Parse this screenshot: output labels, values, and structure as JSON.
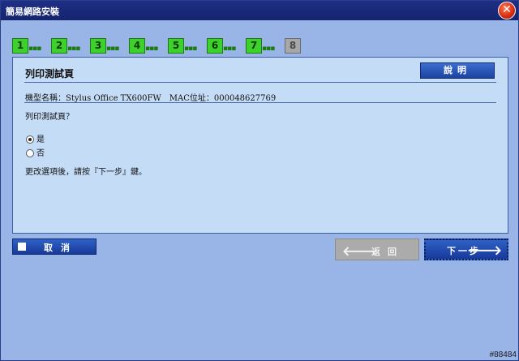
{
  "window": {
    "title": "簡易網路安裝",
    "close_glyph": "✕"
  },
  "steps": [
    {
      "label": "1",
      "dots": "▪▪▪",
      "state": "done"
    },
    {
      "label": "2",
      "dots": "▪▪▪",
      "state": "done"
    },
    {
      "label": "3",
      "dots": "▪▪▪",
      "state": "done"
    },
    {
      "label": "4",
      "dots": "▪▪▪",
      "state": "done"
    },
    {
      "label": "5",
      "dots": "▪▪▪",
      "state": "done"
    },
    {
      "label": "6",
      "dots": "▪▪▪",
      "state": "done"
    },
    {
      "label": "7",
      "dots": "▪▪▪",
      "state": "done"
    },
    {
      "label": "8",
      "dots": "",
      "state": "current"
    }
  ],
  "panel": {
    "title": "列印測試頁",
    "help_label": "說明",
    "model_line": "機型名稱：Stylus Office TX600FW　MAC位址：000048627769",
    "question": "列印測試頁？",
    "options": [
      {
        "label": "是",
        "checked": true
      },
      {
        "label": "否",
        "checked": false
      }
    ],
    "instruction": "更改選項後，請按『下一步』鍵。"
  },
  "buttons": {
    "cancel": "取消",
    "back": "返回",
    "next": "下一步",
    "back_arrow": "🡐",
    "next_arrow": "🡒"
  },
  "footer": {
    "id": "#88484"
  },
  "colors": {
    "titlebar": "#1e2f86",
    "background": "#99b4e6",
    "panel": "#c5dcf7",
    "step_done": "#3fd12b",
    "step_current": "#a7a7a7",
    "button_blue": "#2f61c6",
    "button_disabled": "#ababab"
  }
}
